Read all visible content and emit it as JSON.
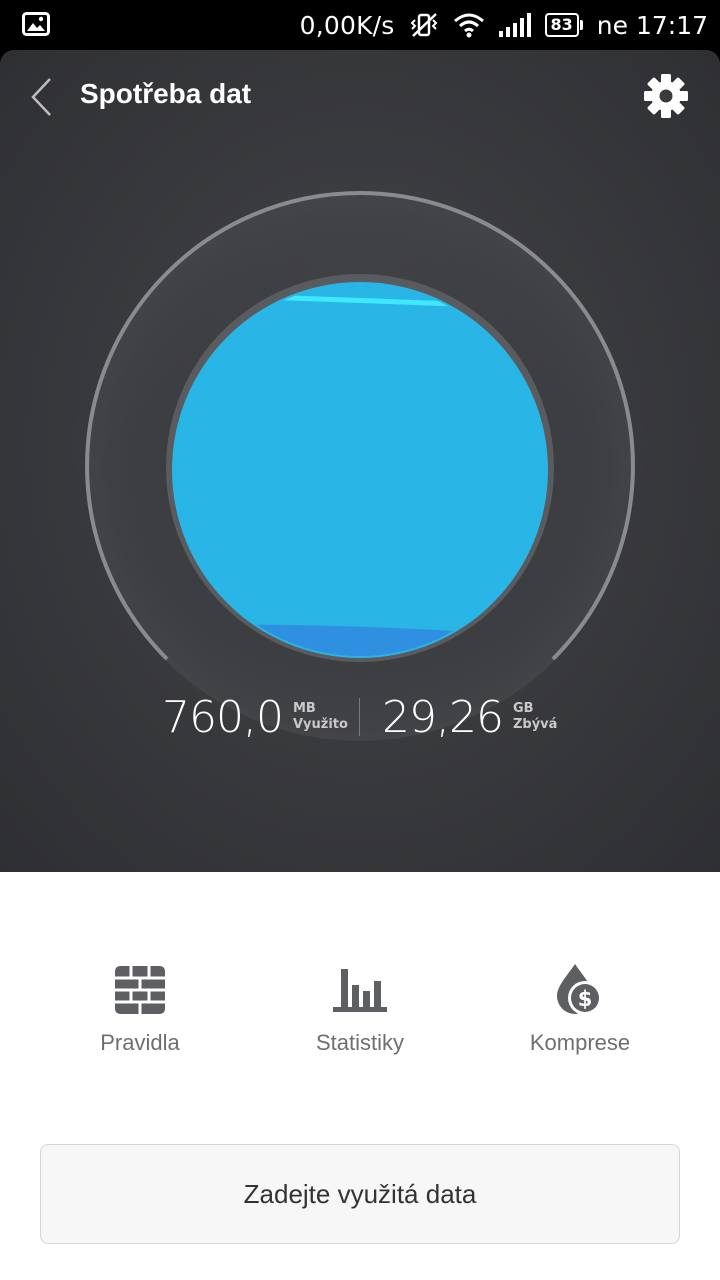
{
  "status_bar": {
    "net_speed": "0,00K/s",
    "battery": "83",
    "day_time": "ne 17:17",
    "icons": [
      "gallery-icon",
      "vibrate-off-icon",
      "wifi-icon",
      "signal-icon",
      "battery-icon"
    ]
  },
  "header": {
    "title": "Spotřeba dat"
  },
  "usage": {
    "used_value": "760,0",
    "used_unit": "MB",
    "used_label": "Využito",
    "remaining_value": "29,26",
    "remaining_unit": "GB",
    "remaining_label": "Zbývá"
  },
  "actions": [
    {
      "label": "Pravidla",
      "icon": "firewall-icon"
    },
    {
      "label": "Statistiky",
      "icon": "bar-chart-icon"
    },
    {
      "label": "Komprese",
      "icon": "compression-drop-icon"
    }
  ],
  "enter_button": {
    "label": "Zadejte využitá data"
  },
  "colors": {
    "water": "#29b5e6",
    "water_dark": "#2f8fe0",
    "water_line": "#3ee8ff",
    "panel_dark": "#3a3b3e"
  }
}
